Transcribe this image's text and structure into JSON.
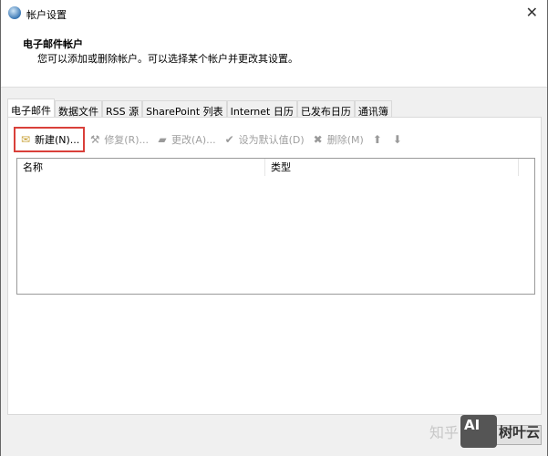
{
  "window": {
    "title": "帐户设置",
    "close": "✕"
  },
  "header": {
    "title": "电子邮件帐户",
    "description": "您可以添加或删除帐户。可以选择某个帐户并更改其设置。"
  },
  "tabs": [
    {
      "label": "电子邮件"
    },
    {
      "label": "数据文件"
    },
    {
      "label": "RSS 源"
    },
    {
      "label": "SharePoint 列表"
    },
    {
      "label": "Internet 日历"
    },
    {
      "label": "已发布日历"
    },
    {
      "label": "通讯簿"
    }
  ],
  "toolbar": {
    "new": "新建(N)...",
    "repair": "修复(R)...",
    "change": "更改(A)...",
    "set_default": "设为默认值(D)",
    "remove": "删除(M)",
    "up": "⬆",
    "down": "⬇"
  },
  "list": {
    "columns": [
      "名称",
      "类型"
    ]
  },
  "watermark": {
    "site": "知乎",
    "logo": "AI",
    "brand": "树叶云"
  }
}
